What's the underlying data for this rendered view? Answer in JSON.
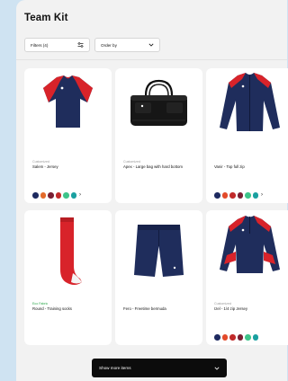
{
  "page": {
    "title": "Team Kit"
  },
  "toolbar": {
    "filters_label": "Filters (4)",
    "filters_icon": "sliders-icon",
    "order_label": "Order by",
    "order_icon": "chevron-down-icon"
  },
  "products": [
    {
      "tag": "Customized",
      "name": "Salem - Jersey",
      "colors": [
        "#1e2a60",
        "#e36a2a",
        "#7a1f33",
        "#c12a2a",
        "#3ec48a",
        "#1aa0a0"
      ]
    },
    {
      "tag": "Customized",
      "name": "Apex - Large bag with hard bottom",
      "colors": []
    },
    {
      "tag": "",
      "name": "Vanir - Top full zip",
      "colors": [
        "#1e2a60",
        "#e34a2a",
        "#c12a2a",
        "#7a1f33",
        "#3ec48a",
        "#1aa0a0"
      ]
    },
    {
      "tag": "Eco Fabric",
      "name": "Round - Training socks",
      "colors": []
    },
    {
      "tag": "",
      "name": "Fero - Freetime bermuda",
      "colors": []
    },
    {
      "tag": "Customized",
      "name": "Izel - 1/4 zip Jersey",
      "colors": [
        "#1e2a60",
        "#e34a2a",
        "#c12a2a",
        "#7a1f33",
        "#3ec48a",
        "#1aa0a0"
      ]
    }
  ],
  "more_colors_symbol": "›",
  "footer": {
    "show_more_label": "Show more items",
    "show_more_icon": "chevron-down-icon"
  },
  "colors": {
    "navy": "#1f2d5c",
    "red": "#d8232a",
    "panel": "#f2f2f2",
    "background": "#cfe3f2"
  }
}
